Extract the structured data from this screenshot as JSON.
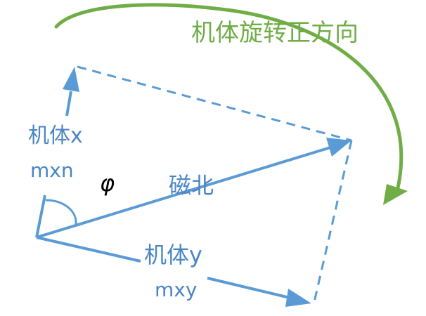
{
  "labels": {
    "rotation": "机体旋转正方向",
    "body_x": "机体x",
    "mxn": "mxn",
    "phi": "φ",
    "north": "磁北",
    "body_y": "机体y",
    "mxy": "mxy"
  },
  "colors": {
    "blue": "#5B9BD5",
    "green": "#70AD47",
    "text_blue": "#4A86C5"
  }
}
